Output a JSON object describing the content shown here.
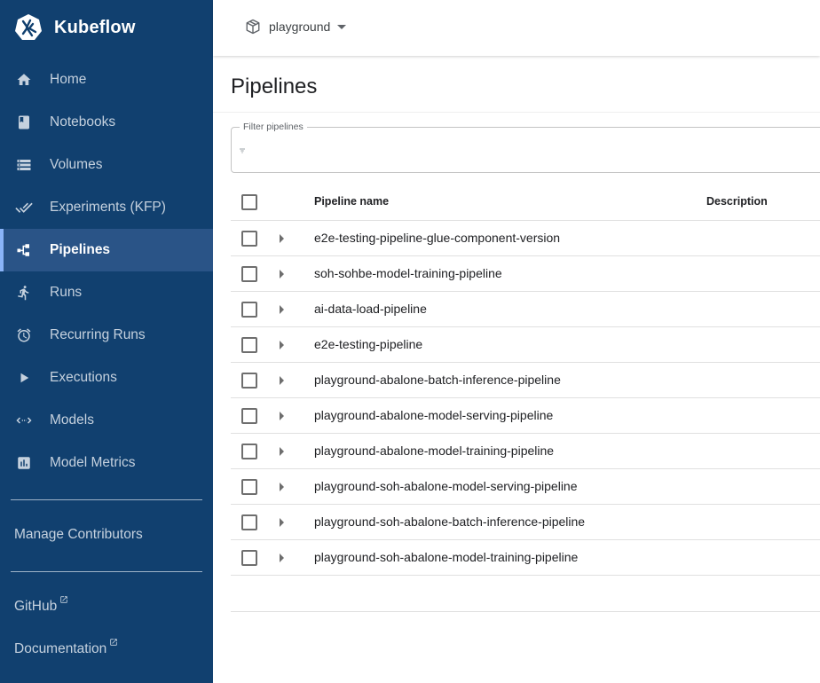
{
  "brand": {
    "name": "Kubeflow"
  },
  "sidebar": {
    "items": [
      {
        "label": "Home",
        "icon": "home-icon"
      },
      {
        "label": "Notebooks",
        "icon": "book-icon"
      },
      {
        "label": "Volumes",
        "icon": "storage-icon"
      },
      {
        "label": "Experiments (KFP)",
        "icon": "done-all-icon"
      },
      {
        "label": "Pipelines",
        "icon": "pipeline-icon",
        "active": true
      },
      {
        "label": "Runs",
        "icon": "run-icon"
      },
      {
        "label": "Recurring Runs",
        "icon": "alarm-icon"
      },
      {
        "label": "Executions",
        "icon": "play-icon"
      },
      {
        "label": "Models",
        "icon": "code-arrows-icon"
      },
      {
        "label": "Model Metrics",
        "icon": "bar-chart-icon"
      }
    ],
    "manage_contributors": "Manage Contributors",
    "github": "GitHub",
    "documentation": "Documentation"
  },
  "topbar": {
    "namespace": "playground"
  },
  "page": {
    "title": "Pipelines",
    "filter_label": "Filter pipelines"
  },
  "table": {
    "columns": {
      "name": "Pipeline name",
      "description": "Description"
    },
    "rows": [
      "e2e-testing-pipeline-glue-component-version",
      "soh-sohbe-model-training-pipeline",
      "ai-data-load-pipeline",
      "e2e-testing-pipeline",
      "playground-abalone-batch-inference-pipeline",
      "playground-abalone-model-serving-pipeline",
      "playground-abalone-model-training-pipeline",
      "playground-soh-abalone-model-serving-pipeline",
      "playground-soh-abalone-batch-inference-pipeline",
      "playground-soh-abalone-model-training-pipeline"
    ]
  },
  "colors": {
    "sidebar_bg": "#11406f",
    "sidebar_active": "#2a5487"
  }
}
